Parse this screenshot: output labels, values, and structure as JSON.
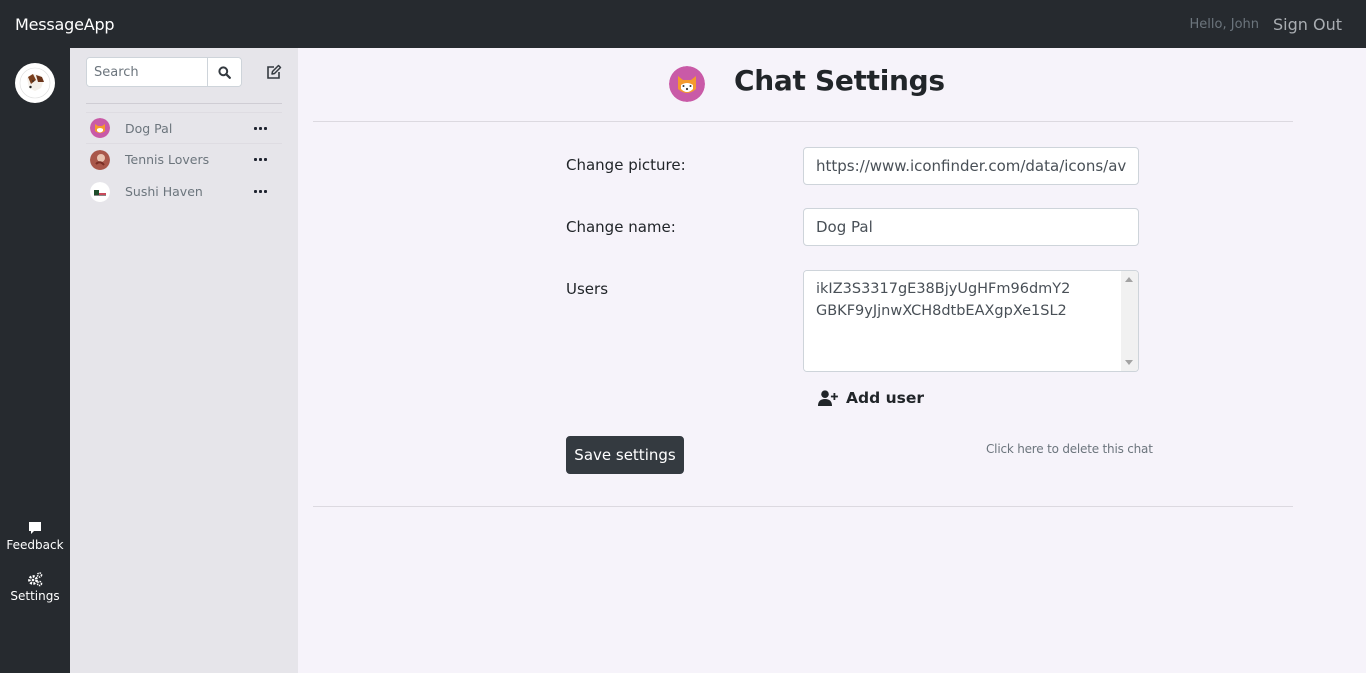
{
  "app": {
    "title": "MessageApp",
    "greeting": "Hello, John",
    "sign_out_label": "Sign Out"
  },
  "leftnav": {
    "items": [
      {
        "label": "Feedback",
        "icon": "comment-icon"
      },
      {
        "label": "Settings",
        "icon": "cogs-icon"
      }
    ]
  },
  "chatlist": {
    "search_placeholder": "Search",
    "search_value": "",
    "chats": [
      {
        "name": "Dog Pal",
        "active": true
      },
      {
        "name": "Tennis Lovers",
        "active": false
      },
      {
        "name": "Sushi Haven",
        "active": false
      }
    ]
  },
  "settings": {
    "title": "Chat Settings",
    "picture_label": "Change picture:",
    "picture_value": "https://www.iconfinder.com/data/icons/avat",
    "name_label": "Change name:",
    "name_value": "Dog Pal",
    "users_label": "Users",
    "users_value": "ikIZ3S3317gE38BjyUgHFm96dmY2\nGBKF9yJjnwXCH8dtbEAXgpXe1SL2",
    "add_user_label": "Add user",
    "save_label": "Save settings",
    "delete_label": "Click here to delete this chat"
  },
  "colors": {
    "topbar": "#262a2f",
    "sidebar": "#e6e5ea",
    "main_bg": "#f6f3fa",
    "dog_avatar_bg": "#c95aa7",
    "button": "#343a40"
  }
}
